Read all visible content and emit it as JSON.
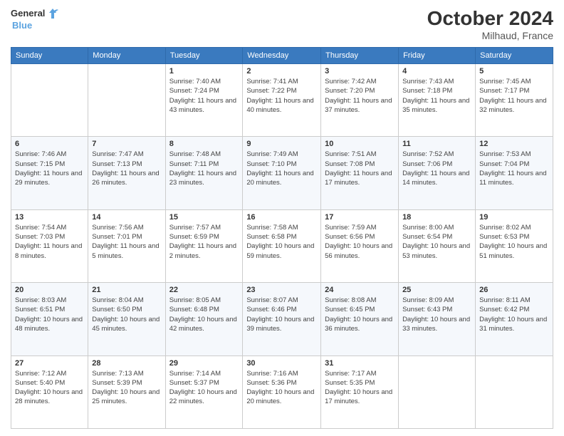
{
  "header": {
    "logo_line1": "General",
    "logo_line2": "Blue",
    "month_year": "October 2024",
    "location": "Milhaud, France"
  },
  "weekdays": [
    "Sunday",
    "Monday",
    "Tuesday",
    "Wednesday",
    "Thursday",
    "Friday",
    "Saturday"
  ],
  "weeks": [
    [
      {
        "day": "",
        "info": ""
      },
      {
        "day": "",
        "info": ""
      },
      {
        "day": "1",
        "info": "Sunrise: 7:40 AM\nSunset: 7:24 PM\nDaylight: 11 hours and 43 minutes."
      },
      {
        "day": "2",
        "info": "Sunrise: 7:41 AM\nSunset: 7:22 PM\nDaylight: 11 hours and 40 minutes."
      },
      {
        "day": "3",
        "info": "Sunrise: 7:42 AM\nSunset: 7:20 PM\nDaylight: 11 hours and 37 minutes."
      },
      {
        "day": "4",
        "info": "Sunrise: 7:43 AM\nSunset: 7:18 PM\nDaylight: 11 hours and 35 minutes."
      },
      {
        "day": "5",
        "info": "Sunrise: 7:45 AM\nSunset: 7:17 PM\nDaylight: 11 hours and 32 minutes."
      }
    ],
    [
      {
        "day": "6",
        "info": "Sunrise: 7:46 AM\nSunset: 7:15 PM\nDaylight: 11 hours and 29 minutes."
      },
      {
        "day": "7",
        "info": "Sunrise: 7:47 AM\nSunset: 7:13 PM\nDaylight: 11 hours and 26 minutes."
      },
      {
        "day": "8",
        "info": "Sunrise: 7:48 AM\nSunset: 7:11 PM\nDaylight: 11 hours and 23 minutes."
      },
      {
        "day": "9",
        "info": "Sunrise: 7:49 AM\nSunset: 7:10 PM\nDaylight: 11 hours and 20 minutes."
      },
      {
        "day": "10",
        "info": "Sunrise: 7:51 AM\nSunset: 7:08 PM\nDaylight: 11 hours and 17 minutes."
      },
      {
        "day": "11",
        "info": "Sunrise: 7:52 AM\nSunset: 7:06 PM\nDaylight: 11 hours and 14 minutes."
      },
      {
        "day": "12",
        "info": "Sunrise: 7:53 AM\nSunset: 7:04 PM\nDaylight: 11 hours and 11 minutes."
      }
    ],
    [
      {
        "day": "13",
        "info": "Sunrise: 7:54 AM\nSunset: 7:03 PM\nDaylight: 11 hours and 8 minutes."
      },
      {
        "day": "14",
        "info": "Sunrise: 7:56 AM\nSunset: 7:01 PM\nDaylight: 11 hours and 5 minutes."
      },
      {
        "day": "15",
        "info": "Sunrise: 7:57 AM\nSunset: 6:59 PM\nDaylight: 11 hours and 2 minutes."
      },
      {
        "day": "16",
        "info": "Sunrise: 7:58 AM\nSunset: 6:58 PM\nDaylight: 10 hours and 59 minutes."
      },
      {
        "day": "17",
        "info": "Sunrise: 7:59 AM\nSunset: 6:56 PM\nDaylight: 10 hours and 56 minutes."
      },
      {
        "day": "18",
        "info": "Sunrise: 8:00 AM\nSunset: 6:54 PM\nDaylight: 10 hours and 53 minutes."
      },
      {
        "day": "19",
        "info": "Sunrise: 8:02 AM\nSunset: 6:53 PM\nDaylight: 10 hours and 51 minutes."
      }
    ],
    [
      {
        "day": "20",
        "info": "Sunrise: 8:03 AM\nSunset: 6:51 PM\nDaylight: 10 hours and 48 minutes."
      },
      {
        "day": "21",
        "info": "Sunrise: 8:04 AM\nSunset: 6:50 PM\nDaylight: 10 hours and 45 minutes."
      },
      {
        "day": "22",
        "info": "Sunrise: 8:05 AM\nSunset: 6:48 PM\nDaylight: 10 hours and 42 minutes."
      },
      {
        "day": "23",
        "info": "Sunrise: 8:07 AM\nSunset: 6:46 PM\nDaylight: 10 hours and 39 minutes."
      },
      {
        "day": "24",
        "info": "Sunrise: 8:08 AM\nSunset: 6:45 PM\nDaylight: 10 hours and 36 minutes."
      },
      {
        "day": "25",
        "info": "Sunrise: 8:09 AM\nSunset: 6:43 PM\nDaylight: 10 hours and 33 minutes."
      },
      {
        "day": "26",
        "info": "Sunrise: 8:11 AM\nSunset: 6:42 PM\nDaylight: 10 hours and 31 minutes."
      }
    ],
    [
      {
        "day": "27",
        "info": "Sunrise: 7:12 AM\nSunset: 5:40 PM\nDaylight: 10 hours and 28 minutes."
      },
      {
        "day": "28",
        "info": "Sunrise: 7:13 AM\nSunset: 5:39 PM\nDaylight: 10 hours and 25 minutes."
      },
      {
        "day": "29",
        "info": "Sunrise: 7:14 AM\nSunset: 5:37 PM\nDaylight: 10 hours and 22 minutes."
      },
      {
        "day": "30",
        "info": "Sunrise: 7:16 AM\nSunset: 5:36 PM\nDaylight: 10 hours and 20 minutes."
      },
      {
        "day": "31",
        "info": "Sunrise: 7:17 AM\nSunset: 5:35 PM\nDaylight: 10 hours and 17 minutes."
      },
      {
        "day": "",
        "info": ""
      },
      {
        "day": "",
        "info": ""
      }
    ]
  ]
}
